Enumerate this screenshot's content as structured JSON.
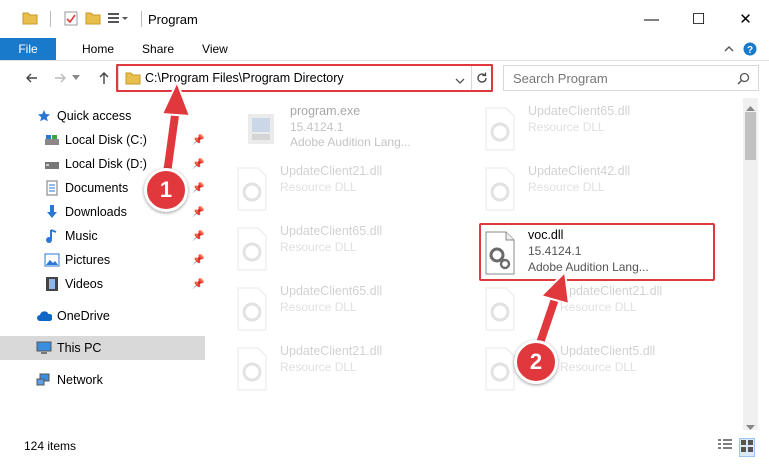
{
  "window": {
    "title": "Program",
    "minimize": "—",
    "maximize": "☐",
    "close": "✕"
  },
  "ribbon": {
    "file": "File",
    "home": "Home",
    "share": "Share",
    "view": "View"
  },
  "address": {
    "path": "C:\\Program Files\\Program Directory",
    "search_placeholder": "Search Program"
  },
  "sidebar": {
    "quick_access": "Quick access",
    "items": [
      {
        "label": "Local Disk (C:)"
      },
      {
        "label": "Local Disk (D:)"
      },
      {
        "label": "Documents"
      },
      {
        "label": "Downloads"
      },
      {
        "label": "Music"
      },
      {
        "label": "Pictures"
      },
      {
        "label": "Videos"
      }
    ],
    "onedrive": "OneDrive",
    "this_pc": "This PC",
    "network": "Network"
  },
  "files": [
    {
      "name": "program.exe",
      "line2": "15.4124.1",
      "line3": "Adobe Audition Lang..."
    },
    {
      "name": "UpdateClient65.dll",
      "line2": "Resource DLL"
    },
    {
      "name": "UpdateClient21.dll",
      "line2": "Resource DLL"
    },
    {
      "name": "UpdateClient42.dll",
      "line2": "Resource DLL"
    },
    {
      "name": "UpdateClient65.dll",
      "line2": "Resource DLL"
    },
    {
      "name": "voc.dll",
      "line2": "15.4124.1",
      "line3": "Adobe Audition Lang..."
    },
    {
      "name": "UpdateClient65.dll",
      "line2": "Resource DLL"
    },
    {
      "name": "UpdateClient21.dll",
      "line2": "Resource DLL"
    },
    {
      "name": "UpdateClient21.dll",
      "line2": "Resource DLL"
    },
    {
      "name": "UpdateClient5.dll",
      "line2": "Resource DLL"
    }
  ],
  "status": {
    "count": "124 items"
  },
  "annotations": {
    "step1": "1",
    "step2": "2"
  },
  "colors": {
    "accent": "#1979ca",
    "highlight": "#e0383c"
  }
}
